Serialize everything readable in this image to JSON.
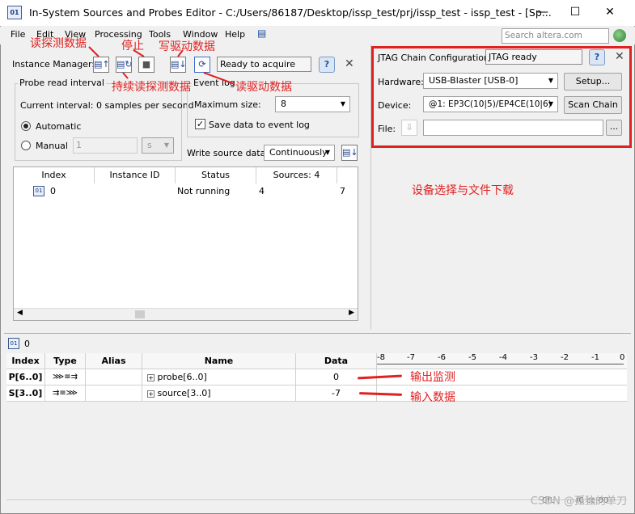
{
  "window": {
    "title": "In-System Sources and Probes Editor - C:/Users/86187/Desktop/issp_test/prj/issp_test - issp_test - [Sp...",
    "minimize": "—",
    "maximize": "☐",
    "close": "✕"
  },
  "menu": [
    "File",
    "Edit",
    "View",
    "Processing",
    "Tools",
    "Window",
    "Help"
  ],
  "search": {
    "placeholder": "Search altera.com"
  },
  "instance_manager": {
    "label": "Instance Manager:",
    "status": "Ready to acquire"
  },
  "probe_interval": {
    "title": "Probe read interval",
    "current": "Current interval:  0 samples per second",
    "automatic": "Automatic",
    "manual": "Manual",
    "manual_value": "1",
    "manual_unit": "s"
  },
  "event_log": {
    "title": "Event log",
    "max_size_label": "Maximum size:",
    "max_size_value": "8",
    "save_label": "Save data to event log"
  },
  "write_source": {
    "label": "Write source data:",
    "value": "Continuously"
  },
  "instance_table": {
    "headers": [
      "Index",
      "Instance ID",
      "Status",
      "Sources: 4",
      ""
    ],
    "row": {
      "index": "0",
      "instance_id": "",
      "status": "Not running",
      "sources": "4",
      "probes": "7"
    }
  },
  "jtag": {
    "config_label": "JTAG Chain Configuration:",
    "config_status": "JTAG ready",
    "hardware_label": "Hardware:",
    "hardware_value": "USB-Blaster [USB-0]",
    "setup_button": "Setup...",
    "device_label": "Device:",
    "device_value": "@1: EP3C(10|5)/EP4CE(10|6)",
    "scan_button": "Scan Chain",
    "file_label": "File:",
    "file_value": "",
    "browse_button": "..."
  },
  "bottom": {
    "instance_label": "0",
    "headers": [
      "Index",
      "Type",
      "Alias",
      "Name",
      "Data"
    ],
    "scale": [
      "-8",
      "-7",
      "-6",
      "-5",
      "-4",
      "-3",
      "-2",
      "-1",
      "0"
    ],
    "rows": [
      {
        "index": "P[6..0]",
        "alias": "",
        "name": "probe[6..0]",
        "data": "0"
      },
      {
        "index": "S[3..0]",
        "alias": "",
        "name": "source[3..0]",
        "data": "-7"
      }
    ],
    "footer_left": "0fL",
    "footer_right": "f0 cc:00"
  },
  "annotations": {
    "read_probe": "读探测数据",
    "stop": "停止",
    "write_drive": "写驱动数据",
    "continuous_read": "持续读探测数据",
    "read_drive": "读驱动数据",
    "device_select": "设备选择与文件下载",
    "output_monitor": "输出监测",
    "input_data": "输入数据"
  },
  "watermark": "CSDN @孤独的单刀",
  "colors": {
    "annotation_red": "#e12020",
    "panel_bg": "#f0f0f0"
  }
}
